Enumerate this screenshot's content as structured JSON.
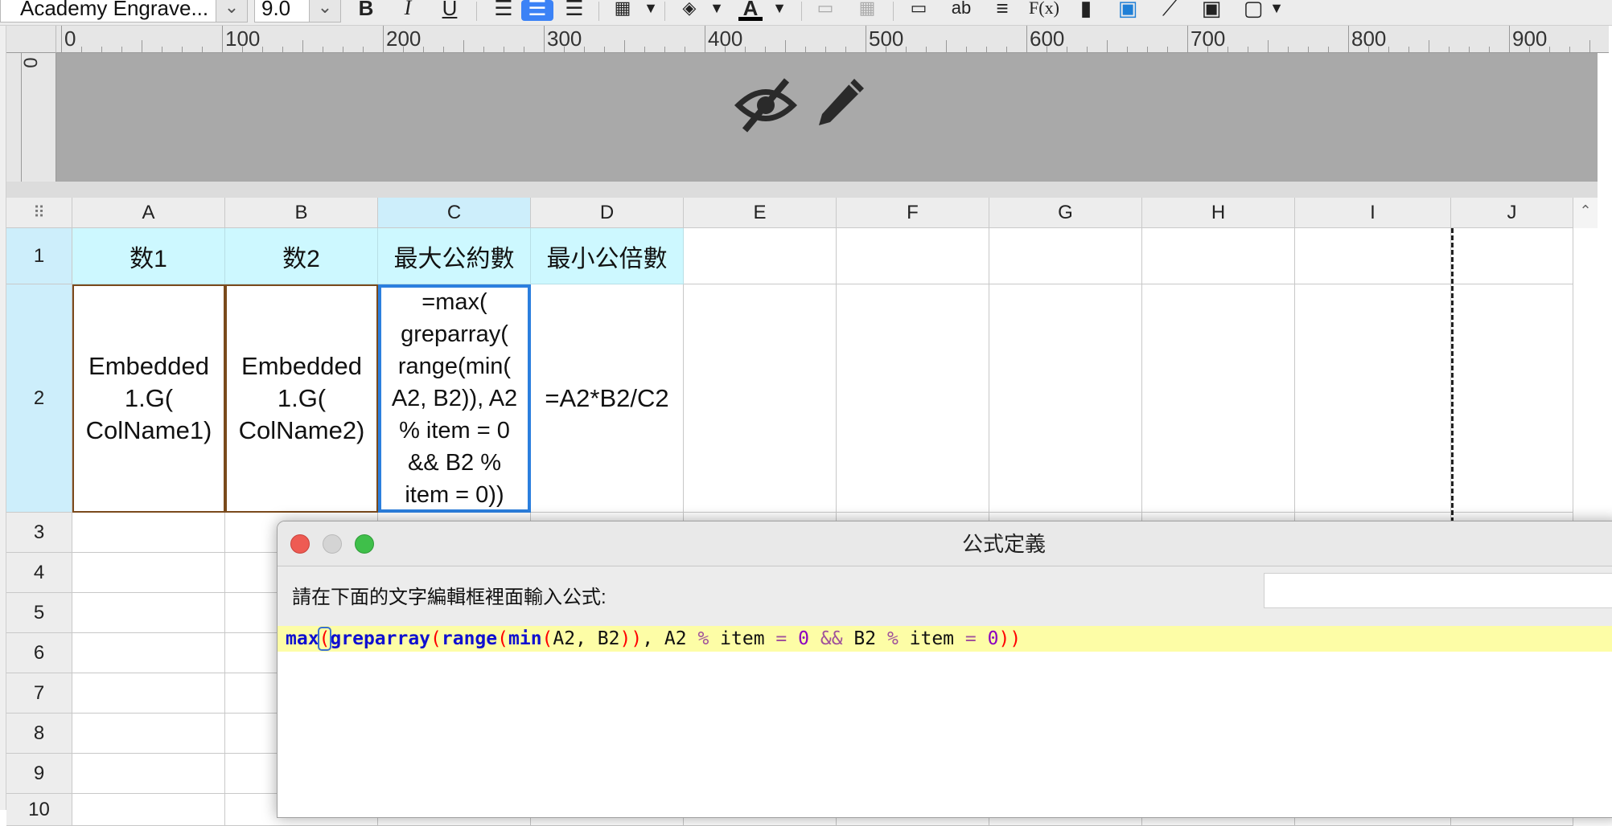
{
  "toolbar": {
    "font_name": "Academy Engrave...",
    "font_size": "9.0",
    "bold": "B",
    "italic": "I",
    "underline": "U",
    "font_color_glyph": "A",
    "text_glyph": "ab",
    "fx_glyph": "F(x)"
  },
  "ruler": {
    "labels": [
      "0",
      "100",
      "200",
      "300",
      "400",
      "500",
      "600",
      "700",
      "800",
      "900"
    ],
    "vertical_zero": "0"
  },
  "columns": [
    "A",
    "B",
    "C",
    "D",
    "E",
    "F",
    "G",
    "H",
    "I",
    "J"
  ],
  "rows": [
    "1",
    "2",
    "3",
    "4",
    "5",
    "6",
    "7",
    "8",
    "9",
    "10"
  ],
  "cells": {
    "A1": "数1",
    "B1": "数2",
    "C1": "最大公約數",
    "D1": "最小公倍數",
    "A2": "Embedded\n1.G(\nColName1)",
    "B2": "Embedded\n1.G(\nColName2)",
    "C2": "=max(\ngreparray(\nrange(min(\nA2, B2)), A2\n% item = 0\n&& B2 %\nitem = 0))",
    "D2": "=A2*B2/C2"
  },
  "colors": {
    "header_cell_bg": "#cdf8ff",
    "selection_border": "#2b7fde",
    "embedded_border": "#7a4a1c",
    "formula_highlight": "#fdfda6",
    "function_color": "#1010d0",
    "paren_color": "#ff0000"
  },
  "dialog": {
    "title": "公式定義",
    "prompt": "請在下面的文字編輯框裡面輸入公式:",
    "formula": {
      "t1": "max",
      "t2": "(",
      "t3": "greparray",
      "t4": "(",
      "t5": "range",
      "t6": "(",
      "t7": "min",
      "t8": "(",
      "t9": "A2, B2",
      "t10": "))",
      "t11": ", A2 ",
      "t12": "%",
      "t13": " item ",
      "t14": "=",
      "t15": " ",
      "t16": "0",
      "t17": " ",
      "t18": "&&",
      "t19": " B2 ",
      "t20": "%",
      "t21": " item ",
      "t22": "=",
      "t23": " ",
      "t24": "0",
      "t25": "))"
    }
  },
  "icons": {
    "hide": "eye-slash-icon",
    "edit": "pencil-icon"
  }
}
